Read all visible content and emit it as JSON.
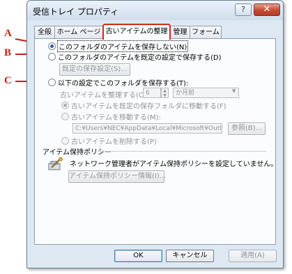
{
  "window": {
    "title": "受信トレイ プロパティ",
    "help_glyph": "?",
    "close_glyph": "✕"
  },
  "tabs": [
    {
      "label": "全般",
      "active": false
    },
    {
      "label": "ホーム ページ",
      "active": false
    },
    {
      "label": "古いアイテムの整理",
      "active": true
    },
    {
      "label": "管理",
      "active": false
    },
    {
      "label": "フォーム",
      "active": false
    }
  ],
  "annotations": {
    "a": "A",
    "b": "B",
    "c": "C",
    "color": "#c81e16"
  },
  "options": {
    "no_archive": "このフォルダのアイテムを保存しない(N)",
    "default_archive": "このフォルダのアイテムを既定の設定で保存する(D)",
    "default_settings_button": "既定の保存設定(S)...",
    "custom_archive": "以下の設定でこのフォルダを保存する(T):",
    "clean_older_label": "古いアイテムを整理する(C)",
    "clean_older_value": "6",
    "clean_older_unit": "か月前",
    "move_default": "古いアイテムを既定の保存フォルダに移動する(F)",
    "move_to": "古いアイテムを移動する(M):",
    "path_value": "C:¥Users¥NEC¥AppData¥Local¥Microsoft¥Outloo",
    "browse_button": "参照(B)...",
    "delete_permanently": "古いアイテムを削除する(P)"
  },
  "policy": {
    "section_title": "アイテム保持ポリシー",
    "message": "ネットワーク管理者がアイテム保持ポリシーを設定していません。",
    "info_button": "アイテム保持ポリシー情報(I)..."
  },
  "footer": {
    "ok": "OK",
    "cancel": "キャンセル",
    "apply": "適用(A)"
  }
}
